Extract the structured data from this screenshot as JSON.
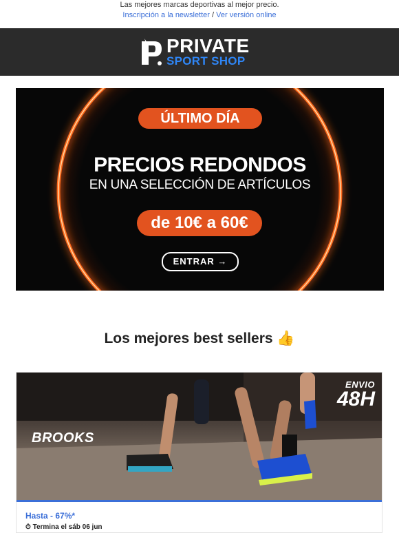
{
  "preheader": {
    "tagline": "Las mejores marcas deportivas al mejor precio.",
    "newsletter_link": "Inscripción a la newsletter",
    "separator": "/",
    "online_link": "Ver versión online"
  },
  "logo": {
    "line1": "PRIVATE",
    "line2": "SPORT SHOP"
  },
  "hero": {
    "badge": "ÚLTIMO DÍA",
    "title": "PRECIOS REDONDOS",
    "subtitle": "EN UNA SELECCIÓN DE ARTÍCULOS",
    "price_range": "de 10€ a 60€",
    "cta": "ENTRAR →"
  },
  "section": {
    "title": "Los mejores best sellers 👍"
  },
  "card": {
    "brand": "BROOKS",
    "shipping_line1": "ENVIO",
    "shipping_line2": "48H",
    "promo": "Hasta - 67%*",
    "ends": "⏱ Termina el sáb 06 jun"
  },
  "colors": {
    "accent_orange": "#e2531f",
    "link_blue": "#3b6fd8",
    "brand_blue": "#2f86f6",
    "header_bg": "#2b2b2b"
  }
}
